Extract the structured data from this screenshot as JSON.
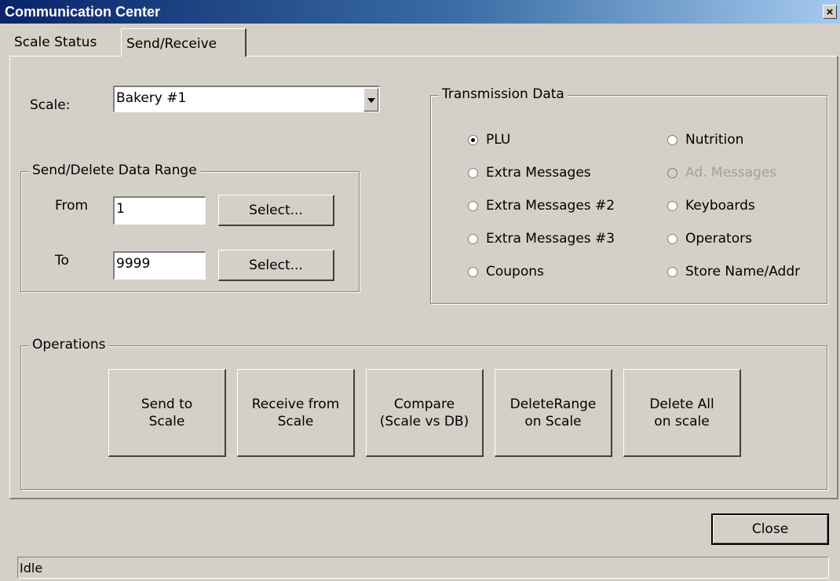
{
  "window": {
    "title": "Communication Center",
    "close_label": "×"
  },
  "tabs": [
    {
      "label": "Scale Status"
    },
    {
      "label": "Send/Receive"
    }
  ],
  "scale": {
    "label": "Scale:",
    "value": "Bakery #1"
  },
  "range": {
    "title": "Send/Delete Data Range",
    "from_label": "From",
    "from_value": "1",
    "to_label": "To",
    "to_value": "9999",
    "select_label": "Select..."
  },
  "transmission": {
    "title": "Transmission Data",
    "left": [
      {
        "label": "PLU",
        "checked": true
      },
      {
        "label": "Extra Messages"
      },
      {
        "label": "Extra Messages #2"
      },
      {
        "label": "Extra Messages #3"
      },
      {
        "label": "Coupons"
      }
    ],
    "right": [
      {
        "label": "Nutrition"
      },
      {
        "label": "Ad. Messages",
        "disabled": true
      },
      {
        "label": "Keyboards"
      },
      {
        "label": "Operators"
      },
      {
        "label": "Store Name/Addr"
      }
    ]
  },
  "operations": {
    "title": "Operations",
    "buttons": [
      {
        "label": "Send to\nScale"
      },
      {
        "label": "Receive from\nScale"
      },
      {
        "label": "Compare\n(Scale vs DB)"
      },
      {
        "label": "DeleteRange\non Scale"
      },
      {
        "label": "Delete All\non scale"
      }
    ]
  },
  "close_button": "Close",
  "status": "Idle"
}
